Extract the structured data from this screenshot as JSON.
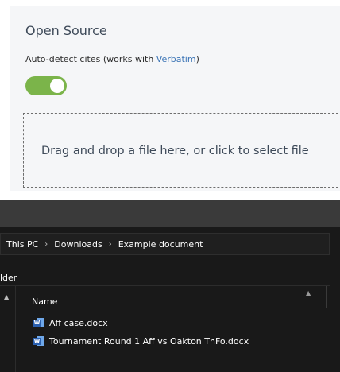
{
  "web": {
    "section_title": "Open Source",
    "toggle_label_prefix": "Auto-detect cites (works with ",
    "toggle_label_link": "Verbatim",
    "toggle_label_suffix": ")",
    "toggle_on": true,
    "dropzone_text": "Drag and drop a file here, or click to select file"
  },
  "explorer": {
    "breadcrumb": [
      "This PC",
      "Downloads",
      "Example document"
    ],
    "breadcrumb_separator": "›",
    "folder_label": "lder",
    "column_header": "Name",
    "files": [
      {
        "name": "Aff case.docx",
        "icon": "word-icon",
        "badge": "W"
      },
      {
        "name": "Tournament Round 1 Aff vs Oakton ThFo.docx",
        "icon": "word-icon",
        "badge": "W"
      }
    ]
  },
  "colors": {
    "toggle_on": "#7bb44a",
    "link": "#3a73b5",
    "explorer_bg": "#191919"
  }
}
